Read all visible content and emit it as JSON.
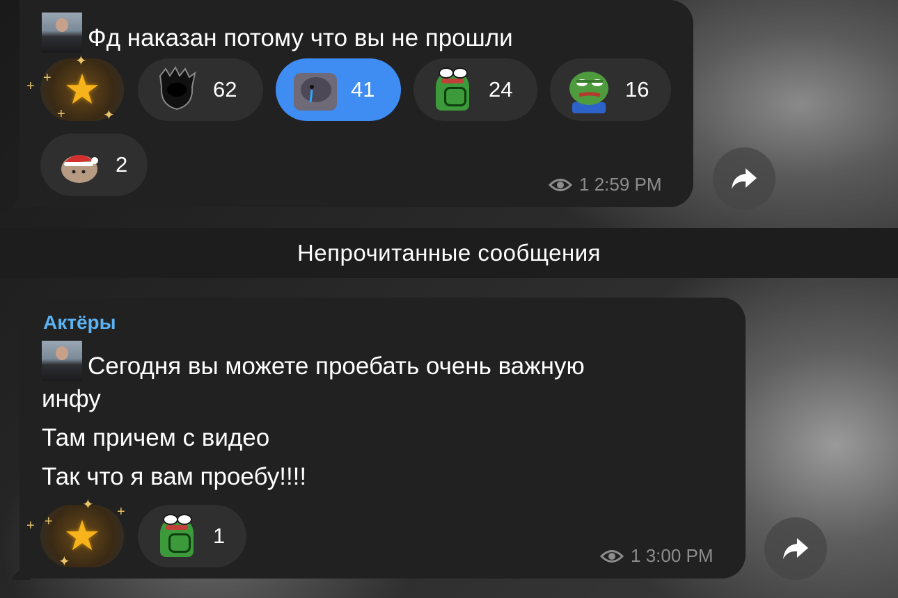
{
  "messages": [
    {
      "text": "Фд наказан потому что вы не прошли",
      "reactions": [
        {
          "type": "star",
          "count": ""
        },
        {
          "emoji": "dark-face-sticker",
          "count": "62",
          "active": false
        },
        {
          "emoji": "crying-hamster-sticker",
          "count": "41",
          "active": true
        },
        {
          "emoji": "pepe-frog-sticker",
          "count": "24",
          "active": false
        },
        {
          "emoji": "pepe-smirk-sticker",
          "count": "16",
          "active": false
        },
        {
          "emoji": "santa-cat-sticker",
          "count": "2",
          "active": false
        }
      ],
      "views": "1",
      "time": "2:59 PM"
    },
    {
      "sender": "Актёры",
      "lines": [
        "Сегодня вы можете проебать очень важную",
        "инфу",
        "Там причем с видео",
        "Так что я вам проебу!!!!"
      ],
      "reactions": [
        {
          "type": "star",
          "count": ""
        },
        {
          "emoji": "pepe-frog-sticker",
          "count": "1",
          "active": false
        }
      ],
      "views": "1",
      "time": "3:00 PM"
    }
  ],
  "unread_divider": "Непрочитанные сообщения",
  "colors": {
    "bubble": "#212121",
    "reaction": "#2f2f2f",
    "reaction_active": "#3f8cf2",
    "sender": "#5bb3f3",
    "meta": "#8d8d8d"
  }
}
